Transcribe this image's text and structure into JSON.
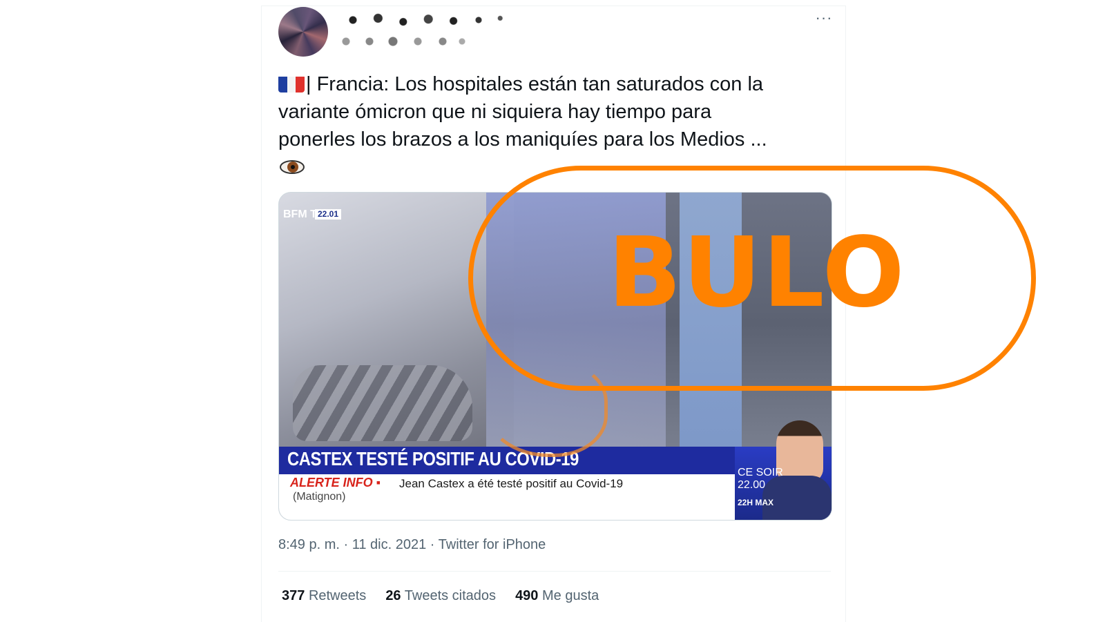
{
  "tweet": {
    "text_line1": "| Francia: Los hospitales están tan saturados con la",
    "text_line2": "variante ómicron que ni siquiera hay tiempo para",
    "text_line3": "ponerles los brazos a los maniquíes para los Medios ...",
    "flag_icon": "france-flag-icon",
    "eye_icon": "eye-icon",
    "more_label": "···",
    "time": "8:49 p. m.",
    "sep1": "·",
    "date": "11 dic. 2021",
    "sep2": "·",
    "source": "Twitter for iPhone"
  },
  "media": {
    "channel_logo": "BFM TV.",
    "channel_time": "22.01",
    "headline": "CASTEX TESTÉ POSITIF AU COVID-19",
    "alert_label": "ALERTE INFO ▪",
    "alert_text": "Jean Castex a été testé positif au Covid-19",
    "alert_source": "(Matignon)",
    "promo_line1": "CE SOIR",
    "promo_line2": "22.00",
    "promo_brand": "22H MAX"
  },
  "stamp": {
    "label": "BULO",
    "color": "#ff8200"
  },
  "stats": {
    "retweets_count": "377",
    "retweets_label": "Retweets",
    "quotes_count": "26",
    "quotes_label": "Tweets citados",
    "likes_count": "490",
    "likes_label": "Me gusta"
  }
}
